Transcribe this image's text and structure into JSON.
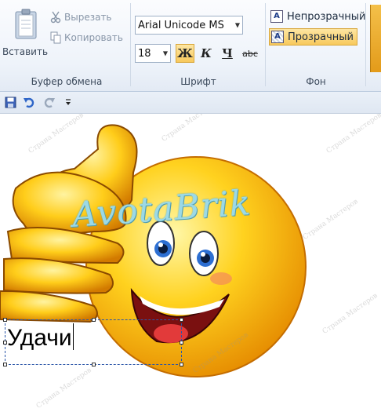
{
  "ribbon": {
    "clipboard": {
      "paste_label": "Вставить",
      "cut_label": "Вырезать",
      "copy_label": "Копировать",
      "group_label": "Буфер обмена"
    },
    "font": {
      "family": "Arial Unicode MS",
      "size": "18",
      "bold_label": "Ж",
      "italic_label": "К",
      "underline_label": "Ч",
      "strike_label": "abc",
      "group_label": "Шрифт"
    },
    "background": {
      "opaque_label": "Непрозрачный",
      "transparent_label": "Прозрачный",
      "group_label": "Фон",
      "selected": "transparent"
    }
  },
  "qat": {
    "icons": [
      "save-icon",
      "undo-icon",
      "redo-icon",
      "customize-dropdown-icon"
    ]
  },
  "canvas": {
    "brand_text": "AvotaBrik",
    "watermark_text": "Страна Мастеров",
    "textbox_text": "Удачи"
  },
  "colors": {
    "accent": "#f8c95d",
    "brand": "#9cd9e6",
    "selection": "#2a55a8"
  }
}
